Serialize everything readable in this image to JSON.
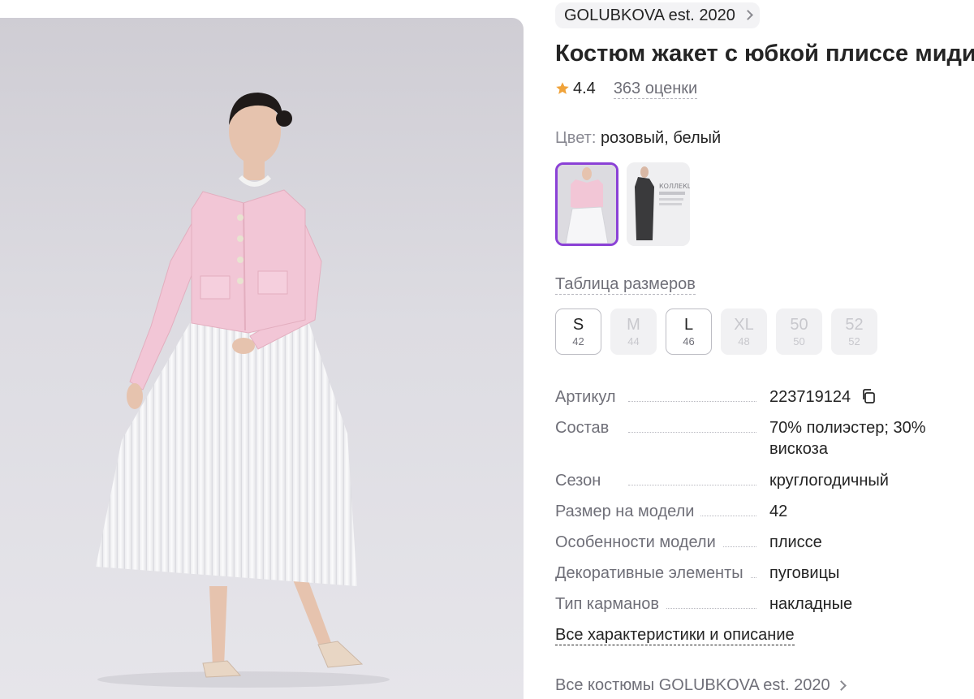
{
  "brand": {
    "label": "GOLUBKOVA est. 2020",
    "icon": "chevron-right-icon"
  },
  "product": {
    "title": "Костюм жакет с юбкой плиссе миди",
    "rating": "4.4",
    "reviews": "363 оценки"
  },
  "color": {
    "label": "Цвет:",
    "value": "розовый, белый"
  },
  "thumbnail_text": "КОЛЛЕКЦИЯ",
  "size_table_label": "Таблица размеров",
  "sizes": [
    {
      "size": "S",
      "ru": "42",
      "available": true
    },
    {
      "size": "M",
      "ru": "44",
      "available": false
    },
    {
      "size": "L",
      "ru": "46",
      "available": true
    },
    {
      "size": "XL",
      "ru": "48",
      "available": false
    },
    {
      "size": "50",
      "ru": "50",
      "available": false
    },
    {
      "size": "52",
      "ru": "52",
      "available": false
    }
  ],
  "specs": [
    {
      "key": "Артикул",
      "value": "223719124"
    },
    {
      "key": "Состав",
      "value": "70% полиэстер; 30% вискоза"
    },
    {
      "key": "Сезон",
      "value": "круглогодичный"
    },
    {
      "key": "Размер на модели",
      "value": "42"
    },
    {
      "key": "Особенности модели",
      "value": "плиссе"
    },
    {
      "key": "Декоративные элементы",
      "value": "пуговицы"
    },
    {
      "key": "Тип карманов",
      "value": "накладные"
    }
  ],
  "all_characteristics_label": "Все характеристики и описание",
  "all_costumes_label": "Все костюмы GOLUBKOVA est. 2020",
  "colors": {
    "accent": "#8b41d6",
    "star": "#f0a33a",
    "jacket": "#f2c6d6"
  }
}
